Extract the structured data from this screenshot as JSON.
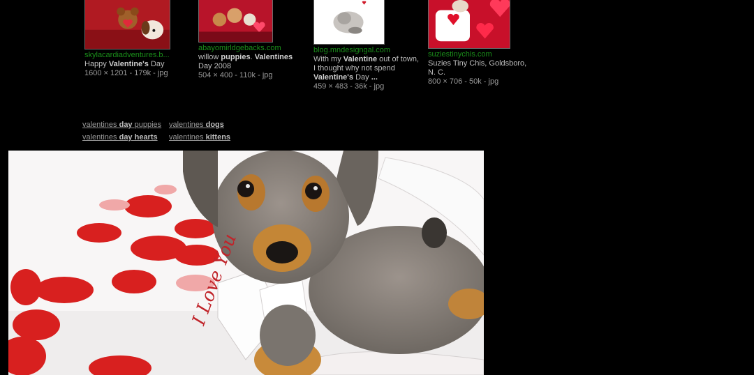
{
  "results": [
    {
      "domain": "skylacardiadventures.b...",
      "caption_pre": "Happy ",
      "caption_bold": "Valentine's",
      "caption_post": " Day",
      "meta": "1600 × 1201 - 179k - jpg"
    },
    {
      "domain": "abayomirldgebacks.com",
      "caption_pre": "willow ",
      "caption_bold": "puppies",
      "caption_mid": ". ",
      "caption_bold2": "Valentines",
      "caption_post": " Day 2008",
      "meta": "504 × 400 - 110k - jpg"
    },
    {
      "domain": "blog.mndesigngal.com",
      "caption_pre": "With my ",
      "caption_bold": "Valentine",
      "caption_mid": " out of town, I thought why not spend ",
      "caption_bold2": "Valentine's",
      "caption_post": " Day ",
      "caption_bold3": "...",
      "meta": "459 × 483 - 36k - jpg"
    },
    {
      "domain": "suziestinychis.com",
      "caption_pre": "Suzies Tiny Chis, Goldsboro, N. C.",
      "meta": "800 × 706 - 50k - jpg"
    }
  ],
  "related": [
    {
      "pre": "valentines ",
      "bold": "day",
      "post": " puppies"
    },
    {
      "pre": "valentines ",
      "bold": "dogs",
      "post": ""
    },
    {
      "pre": "valentines ",
      "bold": "day hearts",
      "post": ""
    },
    {
      "pre": "valentines ",
      "bold": "kittens",
      "post": ""
    }
  ],
  "preview_text": "I Love You",
  "colors": {
    "background": "#000000",
    "domain_green": "#1a8f1a",
    "heart_red": "#d8201f"
  }
}
